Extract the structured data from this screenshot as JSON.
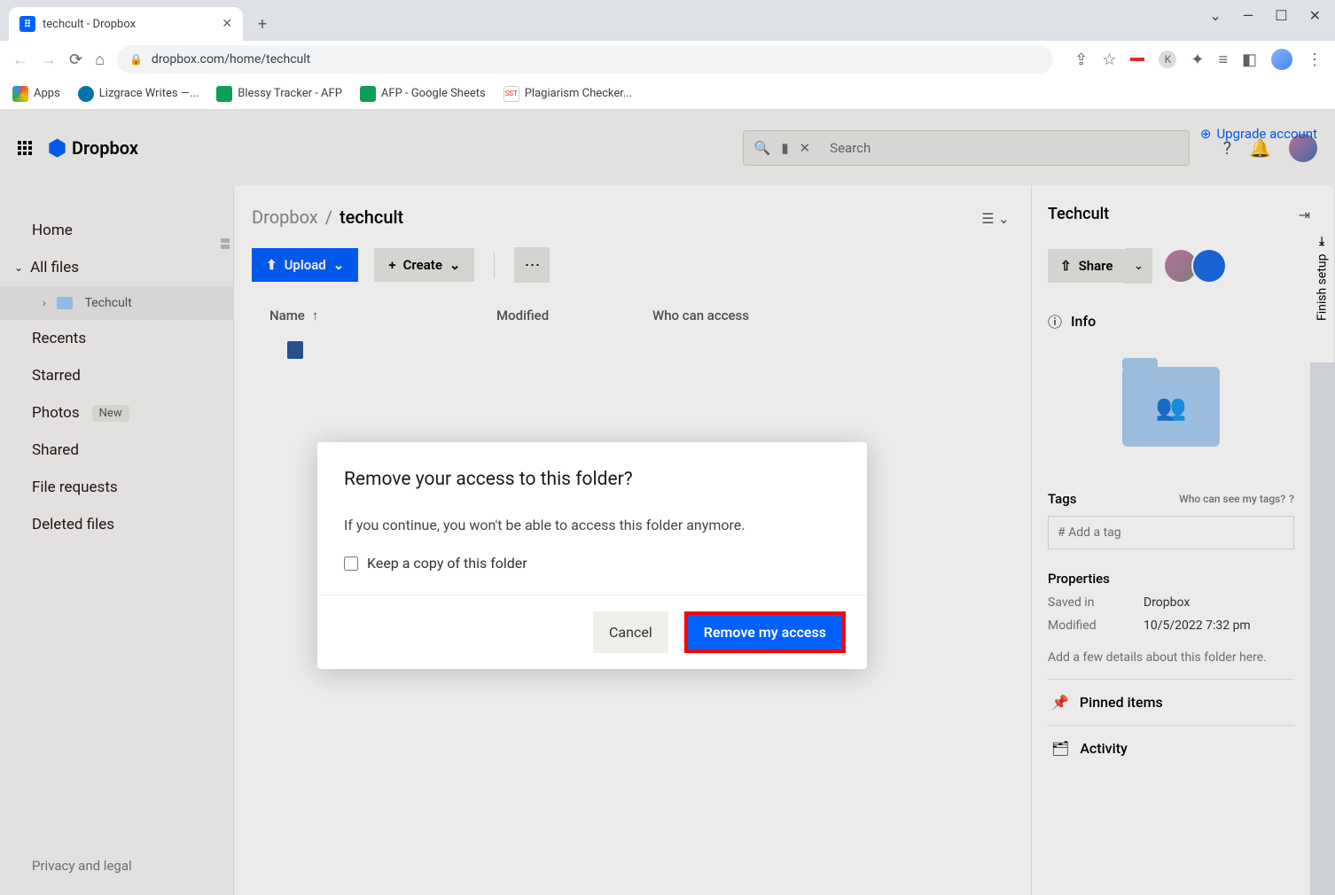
{
  "browser": {
    "tab_title": "techcult - Dropbox",
    "url": "dropbox.com/home/techcult",
    "window_controls": {
      "min": "—",
      "max": "☐",
      "close": "✕",
      "chev": "⌄"
    },
    "bookmarks": [
      {
        "label": "Apps"
      },
      {
        "label": "Lizgrace Writes —..."
      },
      {
        "label": "Blessy Tracker - AFP"
      },
      {
        "label": "AFP - Google Sheets"
      },
      {
        "label": "Plagiarism Checker..."
      }
    ]
  },
  "header": {
    "brand": "Dropbox",
    "upgrade": "Upgrade account",
    "search_placeholder": "Search"
  },
  "sidebar": {
    "home": "Home",
    "all_files": "All files",
    "subfolder": "Techcult",
    "recents": "Recents",
    "starred": "Starred",
    "photos": "Photos",
    "photos_badge": "New",
    "shared": "Shared",
    "file_requests": "File requests",
    "deleted": "Deleted files",
    "footer": "Privacy and legal"
  },
  "main": {
    "breadcrumb_root": "Dropbox",
    "breadcrumb_current": "techcult",
    "upload": "Upload",
    "create": "Create",
    "columns": {
      "name": "Name",
      "modified": "Modified",
      "access": "Who can access"
    }
  },
  "rightpanel": {
    "title": "Techcult",
    "share": "Share",
    "info": "Info",
    "tags": "Tags",
    "tags_help": "Who can see my tags?",
    "tag_placeholder": "# Add a tag",
    "properties": "Properties",
    "saved_in_label": "Saved in",
    "saved_in_value": "Dropbox",
    "modified_label": "Modified",
    "modified_value": "10/5/2022 7:32 pm",
    "add_details": "Add a few details about this folder here.",
    "pinned": "Pinned items",
    "activity": "Activity"
  },
  "finish_setup": "Finish setup",
  "modal": {
    "title": "Remove your access to this folder?",
    "body": "If you continue, you won't be able to access this folder anymore.",
    "checkbox": "Keep a copy of this folder",
    "cancel": "Cancel",
    "confirm": "Remove my access"
  }
}
